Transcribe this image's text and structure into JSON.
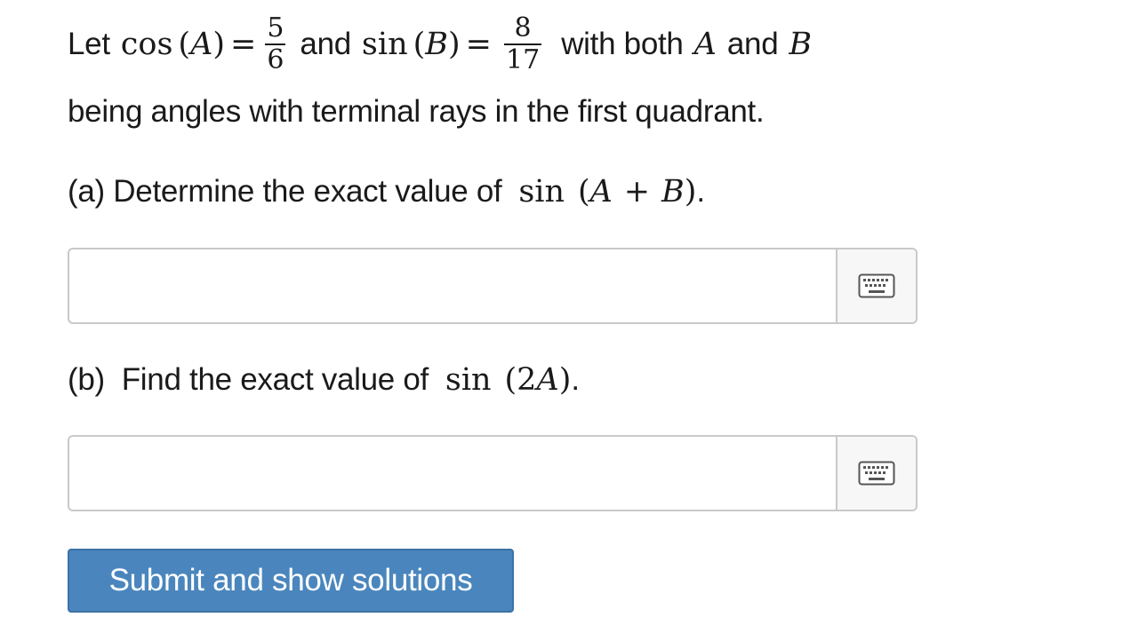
{
  "problem": {
    "intro_let": "Let",
    "cos_fn": "cos",
    "var_A": "A",
    "var_B": "B",
    "open_paren": "(",
    "close_paren": ")",
    "equals": "=",
    "cos_num": "5",
    "cos_den": "6",
    "and_text": "and",
    "sin_fn": "sin",
    "sin_num": "8",
    "sin_den": "17",
    "with_both": "with both",
    "and_text2": "and",
    "line2": "being angles with terminal rays in the first quadrant."
  },
  "part_a": {
    "prefix": "(a) Determine the exact value of",
    "fn": "sin",
    "open": "(",
    "A": "A",
    "plus": "+",
    "B": "B",
    "close": ")",
    "period": "."
  },
  "part_b": {
    "prefix": "(b)  Find the exact value of",
    "fn": "sin",
    "open": "(",
    "two": "2",
    "A": "A",
    "close": ")",
    "period": "."
  },
  "answer_a": {
    "value": "",
    "keyboard_icon": "keyboard-icon"
  },
  "answer_b": {
    "value": "",
    "keyboard_icon": "keyboard-icon"
  },
  "submit": {
    "label": "Submit and show solutions",
    "color": "#4a86bd"
  }
}
